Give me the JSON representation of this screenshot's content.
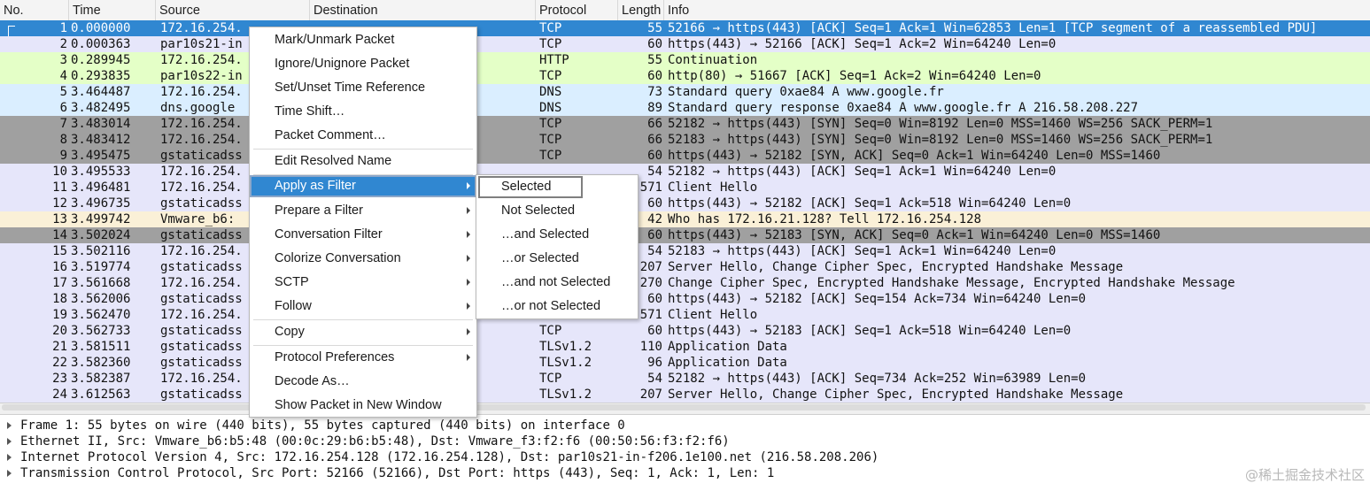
{
  "columns": {
    "no": "No.",
    "time": "Time",
    "source": "Source",
    "destination": "Destination",
    "protocol": "Protocol",
    "length": "Length",
    "info": "Info"
  },
  "packets": [
    {
      "no": "1",
      "time": "0.000000",
      "src": "172.16.254.",
      "dst": "",
      "proto": "TCP",
      "len": "55",
      "info": "52166 → https(443) [ACK] Seq=1 Ack=1 Win=62853 Len=1 [TCP segment of a reassembled PDU]",
      "style": "selected"
    },
    {
      "no": "2",
      "time": "0.000363",
      "src": "par10s21-in",
      "dst": "",
      "proto": "TCP",
      "len": "60",
      "info": "https(443) → 52166 [ACK] Seq=1 Ack=2 Win=64240 Len=0",
      "style": "tcp"
    },
    {
      "no": "3",
      "time": "0.289945",
      "src": "172.16.254.",
      "dst": "",
      "proto": "HTTP",
      "len": "55",
      "info": "Continuation",
      "style": "http"
    },
    {
      "no": "4",
      "time": "0.293835",
      "src": "par10s22-in",
      "dst": "",
      "proto": "TCP",
      "len": "60",
      "info": "http(80) → 51667 [ACK] Seq=1 Ack=2 Win=64240 Len=0",
      "style": "http"
    },
    {
      "no": "5",
      "time": "3.464487",
      "src": "172.16.254.",
      "dst": "",
      "proto": "DNS",
      "len": "73",
      "info": "Standard query 0xae84 A www.google.fr",
      "style": "dns"
    },
    {
      "no": "6",
      "time": "3.482495",
      "src": "dns.google",
      "dst": "",
      "proto": "DNS",
      "len": "89",
      "info": "Standard query response 0xae84 A www.google.fr A 216.58.208.227",
      "style": "dns"
    },
    {
      "no": "7",
      "time": "3.483014",
      "src": "172.16.254.",
      "dst": "",
      "proto": "TCP",
      "len": "66",
      "info": "52182 → https(443) [SYN] Seq=0 Win=8192 Len=0 MSS=1460 WS=256 SACK_PERM=1",
      "style": "syn"
    },
    {
      "no": "8",
      "time": "3.483412",
      "src": "172.16.254.",
      "dst": "",
      "proto": "TCP",
      "len": "66",
      "info": "52183 → https(443) [SYN] Seq=0 Win=8192 Len=0 MSS=1460 WS=256 SACK_PERM=1",
      "style": "syn"
    },
    {
      "no": "9",
      "time": "3.495475",
      "src": "gstaticadss",
      "dst": "",
      "proto": "TCP",
      "len": "60",
      "info": "https(443) → 52182 [SYN, ACK] Seq=0 Ack=1 Win=64240 Len=0 MSS=1460",
      "style": "syn"
    },
    {
      "no": "10",
      "time": "3.495533",
      "src": "172.16.254.",
      "dst": "",
      "proto": "",
      "len": "54",
      "info": "52182 → https(443) [ACK] Seq=1 Ack=1 Win=64240 Len=0",
      "style": "tcp"
    },
    {
      "no": "11",
      "time": "3.496481",
      "src": "172.16.254.",
      "dst": "",
      "proto": "",
      "len": "571",
      "info": "Client Hello",
      "style": "tcp"
    },
    {
      "no": "12",
      "time": "3.496735",
      "src": "gstaticadss",
      "dst": "",
      "proto": "",
      "len": "60",
      "info": "https(443) → 52182 [ACK] Seq=1 Ack=518 Win=64240 Len=0",
      "style": "tcp"
    },
    {
      "no": "13",
      "time": "3.499742",
      "src": "Vmware_b6:",
      "dst": "",
      "proto": "",
      "len": "42",
      "info": "Who has 172.16.21.128? Tell 172.16.254.128",
      "style": "arp"
    },
    {
      "no": "14",
      "time": "3.502024",
      "src": "gstaticadss",
      "dst": "",
      "proto": "",
      "len": "60",
      "info": "https(443) → 52183 [SYN, ACK] Seq=0 Ack=1 Win=64240 Len=0 MSS=1460",
      "style": "syn"
    },
    {
      "no": "15",
      "time": "3.502116",
      "src": "172.16.254.",
      "dst": "",
      "proto": "",
      "len": "54",
      "info": "52183 → https(443) [ACK] Seq=1 Ack=1 Win=64240 Len=0",
      "style": "tcp"
    },
    {
      "no": "16",
      "time": "3.519774",
      "src": "gstaticadss",
      "dst": "",
      "proto": "",
      "len": "207",
      "info": "Server Hello, Change Cipher Spec, Encrypted Handshake Message",
      "style": "tls"
    },
    {
      "no": "17",
      "time": "3.561668",
      "src": "172.16.254.",
      "dst": "",
      "proto": "",
      "len": "270",
      "info": "Change Cipher Spec, Encrypted Handshake Message, Encrypted Handshake Message",
      "style": "tls"
    },
    {
      "no": "18",
      "time": "3.562006",
      "src": "gstaticadss",
      "dst": "",
      "proto": "",
      "len": "60",
      "info": "https(443) → 52182 [ACK] Seq=154 Ack=734 Win=64240 Len=0",
      "style": "tcp"
    },
    {
      "no": "19",
      "time": "3.562470",
      "src": "172.16.254.",
      "dst": "",
      "proto": "",
      "len": "571",
      "info": "Client Hello",
      "style": "tls"
    },
    {
      "no": "20",
      "time": "3.562733",
      "src": "gstaticadss",
      "dst": "",
      "proto": "TCP",
      "len": "60",
      "info": "https(443) → 52183 [ACK] Seq=1 Ack=518 Win=64240 Len=0",
      "style": "tcp"
    },
    {
      "no": "21",
      "time": "3.581511",
      "src": "gstaticadss",
      "dst": "",
      "proto": "TLSv1.2",
      "len": "110",
      "info": "Application Data",
      "style": "tls"
    },
    {
      "no": "22",
      "time": "3.582360",
      "src": "gstaticadss",
      "dst": "",
      "proto": "TLSv1.2",
      "len": "96",
      "info": "Application Data",
      "style": "tls"
    },
    {
      "no": "23",
      "time": "3.582387",
      "src": "172.16.254.",
      "dst": "",
      "proto": "TCP",
      "len": "54",
      "info": "52182 → https(443) [ACK] Seq=734 Ack=252 Win=63989 Len=0",
      "style": "tcp"
    },
    {
      "no": "24",
      "time": "3.612563",
      "src": "gstaticadss",
      "dst": "",
      "proto": "TLSv1.2",
      "len": "207",
      "info": "Server Hello, Change Cipher Spec, Encrypted Handshake Message",
      "style": "tls"
    }
  ],
  "details": [
    "Frame 1: 55 bytes on wire (440 bits), 55 bytes captured (440 bits) on interface 0",
    "Ethernet II, Src: Vmware_b6:b5:48 (00:0c:29:b6:b5:48), Dst: Vmware_f3:f2:f6 (00:50:56:f3:f2:f6)",
    "Internet Protocol Version 4, Src: 172.16.254.128 (172.16.254.128), Dst: par10s21-in-f206.1e100.net (216.58.208.206)",
    "Transmission Control Protocol, Src Port: 52166 (52166), Dst Port: https (443), Seq: 1, Ack: 1, Len: 1"
  ],
  "context_menu": {
    "items": [
      {
        "label": "Mark/Unmark Packet",
        "submenu": false
      },
      {
        "label": "Ignore/Unignore Packet",
        "submenu": false
      },
      {
        "label": "Set/Unset Time Reference",
        "submenu": false
      },
      {
        "label": "Time Shift…",
        "submenu": false
      },
      {
        "label": "Packet Comment…",
        "submenu": false
      },
      {
        "label": "Edit Resolved Name",
        "submenu": false
      },
      {
        "label": "Apply as Filter",
        "submenu": true,
        "active": true
      },
      {
        "label": "Prepare a Filter",
        "submenu": true
      },
      {
        "label": "Conversation Filter",
        "submenu": true
      },
      {
        "label": "Colorize Conversation",
        "submenu": true
      },
      {
        "label": "SCTP",
        "submenu": true
      },
      {
        "label": "Follow",
        "submenu": true
      },
      {
        "label": "Copy",
        "submenu": true
      },
      {
        "label": "Protocol Preferences",
        "submenu": true
      },
      {
        "label": "Decode As…",
        "submenu": false
      },
      {
        "label": "Show Packet in New Window",
        "submenu": false
      }
    ]
  },
  "apply_filter_submenu": {
    "items": [
      {
        "label": "Selected",
        "focused": true
      },
      {
        "label": "Not Selected"
      },
      {
        "label": "…and Selected"
      },
      {
        "label": "…or Selected"
      },
      {
        "label": "…and not Selected"
      },
      {
        "label": "…or not Selected"
      }
    ]
  },
  "watermark": "@稀土掘金技术社区"
}
